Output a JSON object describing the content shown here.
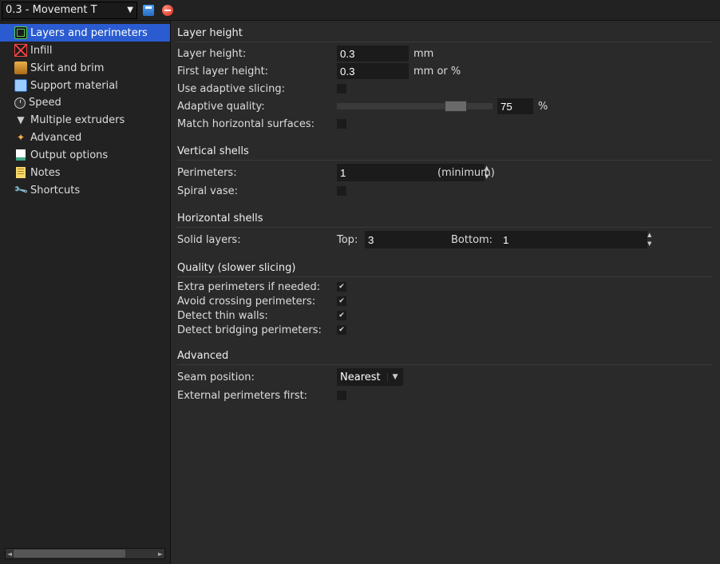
{
  "preset_name": "0.3 - Movement T",
  "sidebar": {
    "items": [
      {
        "label": "Layers and perimeters",
        "icon": "layers-icon",
        "selected": true
      },
      {
        "label": "Infill",
        "icon": "infill-icon"
      },
      {
        "label": "Skirt and brim",
        "icon": "skirt-icon"
      },
      {
        "label": "Support material",
        "icon": "support-icon"
      },
      {
        "label": "Speed",
        "icon": "speed-icon"
      },
      {
        "label": "Multiple extruders",
        "icon": "extruders-icon"
      },
      {
        "label": "Advanced",
        "icon": "advanced-icon"
      },
      {
        "label": "Output options",
        "icon": "output-icon"
      },
      {
        "label": "Notes",
        "icon": "notes-icon"
      },
      {
        "label": "Shortcuts",
        "icon": "shortcuts-icon"
      }
    ]
  },
  "sections": {
    "layer_height": {
      "title": "Layer height",
      "layer_height_label": "Layer height:",
      "layer_height_value": "0.3",
      "layer_height_unit": "mm",
      "first_layer_label": "First layer height:",
      "first_layer_value": "0.3",
      "first_layer_unit": "mm or %",
      "adaptive_slicing_label": "Use adaptive slicing:",
      "adaptive_slicing_checked": false,
      "adaptive_quality_label": "Adaptive quality:",
      "adaptive_quality_value": "75",
      "adaptive_quality_unit": "%",
      "match_horizontal_label": "Match horizontal surfaces:",
      "match_horizontal_checked": false
    },
    "vertical_shells": {
      "title": "Vertical shells",
      "perimeters_label": "Perimeters:",
      "perimeters_value": "1",
      "perimeters_suffix": "(minimum)",
      "spiral_vase_label": "Spiral vase:",
      "spiral_vase_checked": false
    },
    "horizontal_shells": {
      "title": "Horizontal shells",
      "solid_layers_label": "Solid layers:",
      "top_label": "Top:",
      "top_value": "3",
      "bottom_label": "Bottom:",
      "bottom_value": "1"
    },
    "quality": {
      "title": "Quality (slower slicing)",
      "extra_perimeters_label": "Extra perimeters if needed:",
      "extra_perimeters_checked": true,
      "avoid_crossing_label": "Avoid crossing perimeters:",
      "avoid_crossing_checked": true,
      "detect_thin_label": "Detect thin walls:",
      "detect_thin_checked": true,
      "detect_bridging_label": "Detect bridging perimeters:",
      "detect_bridging_checked": true
    },
    "advanced": {
      "title": "Advanced",
      "seam_position_label": "Seam position:",
      "seam_position_value": "Nearest",
      "external_first_label": "External perimeters first:",
      "external_first_checked": false
    }
  }
}
